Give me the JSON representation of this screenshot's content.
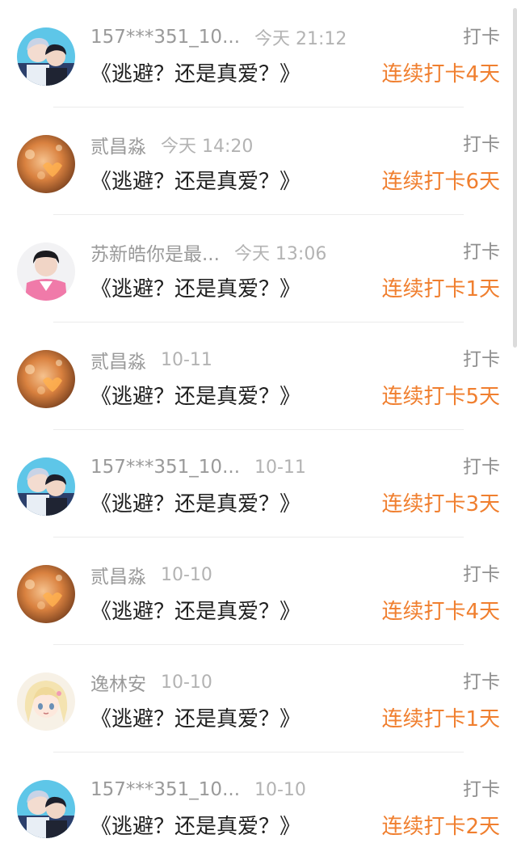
{
  "colors": {
    "accent": "#f07f2f",
    "name": "#9a9a9a",
    "time": "#b3b3b3",
    "title": "#1e1e1e"
  },
  "items": [
    {
      "name": "157***351_10...",
      "time": "今天 21:12",
      "tag": "打卡",
      "title": "《逃避？还是真爱？》",
      "streak": "连续打卡4天",
      "avatar": "avatar-pair"
    },
    {
      "name": "贰昌淼",
      "time": "今天 14:20",
      "tag": "打卡",
      "title": "《逃避？还是真爱？》",
      "streak": "连续打卡6天",
      "avatar": "avatar-warm"
    },
    {
      "name": "苏新皓你是最...",
      "time": "今天 13:06",
      "tag": "打卡",
      "title": "《逃避？还是真爱？》",
      "streak": "连续打卡1天",
      "avatar": "avatar-pink"
    },
    {
      "name": "贰昌淼",
      "time": "10-11",
      "tag": "打卡",
      "title": "《逃避？还是真爱？》",
      "streak": "连续打卡5天",
      "avatar": "avatar-warm"
    },
    {
      "name": "157***351_10...",
      "time": "10-11",
      "tag": "打卡",
      "title": "《逃避？还是真爱？》",
      "streak": "连续打卡3天",
      "avatar": "avatar-pair"
    },
    {
      "name": "贰昌淼",
      "time": "10-10",
      "tag": "打卡",
      "title": "《逃避？还是真爱？》",
      "streak": "连续打卡4天",
      "avatar": "avatar-warm"
    },
    {
      "name": "逸林安",
      "time": "10-10",
      "tag": "打卡",
      "title": "《逃避？还是真爱？》",
      "streak": "连续打卡1天",
      "avatar": "avatar-anime"
    },
    {
      "name": "157***351_10...",
      "time": "10-10",
      "tag": "打卡",
      "title": "《逃避？还是真爱？》",
      "streak": "连续打卡2天",
      "avatar": "avatar-pair"
    }
  ]
}
